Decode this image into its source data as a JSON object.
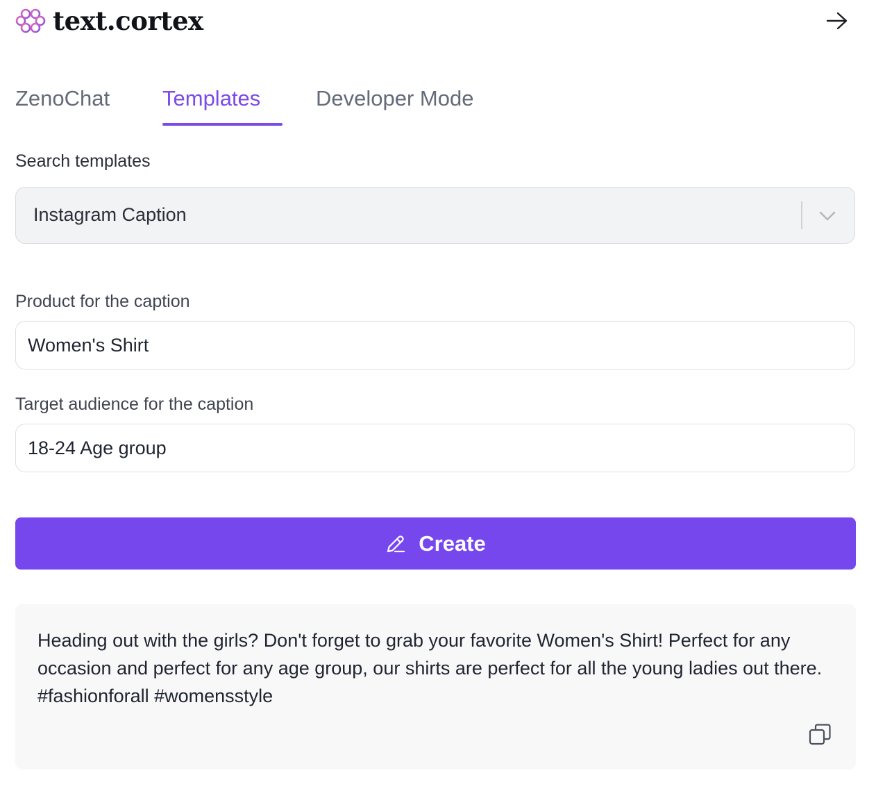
{
  "brand": {
    "logo_text": "text.cortex",
    "logo_icon": "brain-icon",
    "colors": {
      "accent": "#7747ee",
      "tab_active": "#7c4ae8",
      "logo_gradient": [
        "#e46bb4",
        "#8a4fe0"
      ]
    }
  },
  "header": {
    "collapse_icon": "arrow-right-icon"
  },
  "tabs": [
    {
      "label": "ZenoChat",
      "active": false
    },
    {
      "label": "Templates",
      "active": true
    },
    {
      "label": "Developer Mode",
      "active": false
    }
  ],
  "template_search": {
    "label": "Search templates",
    "selected": "Instagram Caption",
    "dropdown_icon": "chevron-down-icon"
  },
  "form": {
    "product": {
      "label": "Product for the caption",
      "value": "Women's Shirt"
    },
    "audience": {
      "label": "Target audience for the caption",
      "value": "18-24 Age group"
    }
  },
  "create_button": {
    "label": "Create",
    "icon": "pencil-icon"
  },
  "output": {
    "text": "Heading out with the girls? Don't forget to grab your favorite Women's Shirt! Perfect for any occasion and perfect for any age group, our shirts are perfect for all the young ladies out there. #fashionforall #womensstyle",
    "copy_icon": "copy-icon"
  }
}
